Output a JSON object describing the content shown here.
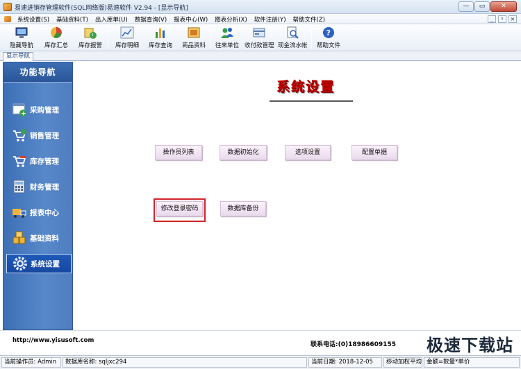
{
  "window": {
    "title": "易速进销存管理软件(SQL网络版)易速软件 V2.94 - [显示导航]",
    "minimize": "—",
    "restore": "▭",
    "close": "✕"
  },
  "menu": {
    "items": [
      "系统设置(S)",
      "基础资料(T)",
      "出入库单(U)",
      "数据查询(V)",
      "报表中心(W)",
      "图表分析(X)",
      "软件注册(Y)",
      "帮助文件(Z)"
    ],
    "mdi": [
      "_",
      "ᵡ",
      "×"
    ]
  },
  "toolbar": {
    "items": [
      "隐藏导航",
      "库存汇总",
      "库存报警",
      "库存明细",
      "库存查询",
      "商品资料",
      "往来单位",
      "收付款管理",
      "现金流水帐",
      "帮助文件"
    ]
  },
  "tab": {
    "label": "显示导航"
  },
  "nav": {
    "header": "功能导航",
    "items": [
      "采购管理",
      "销售管理",
      "库存管理",
      "财务管理",
      "报表中心",
      "基础资料",
      "系统设置"
    ],
    "active": "系统设置"
  },
  "main": {
    "title": "系统设置",
    "buttons": [
      "操作员列表",
      "数据初始化",
      "选项设置",
      "配置单据",
      "修改登录密码",
      "数据库备份"
    ]
  },
  "footer": {
    "url": "http://www.yisusoft.com",
    "phone": "联系电话:(0)18986609155"
  },
  "status": {
    "operator": "当前操作员: Admin",
    "database": "数据库名称: sqljxc294",
    "date": "当前日期: 2018-12-05",
    "method": "移动加权平均",
    "amount": "金额=数量*单价"
  },
  "watermark": "极速下载站",
  "colors": {
    "nav_bg": "#4f7dc0",
    "title_red": "#c00000",
    "highlight": "#d2232a"
  }
}
